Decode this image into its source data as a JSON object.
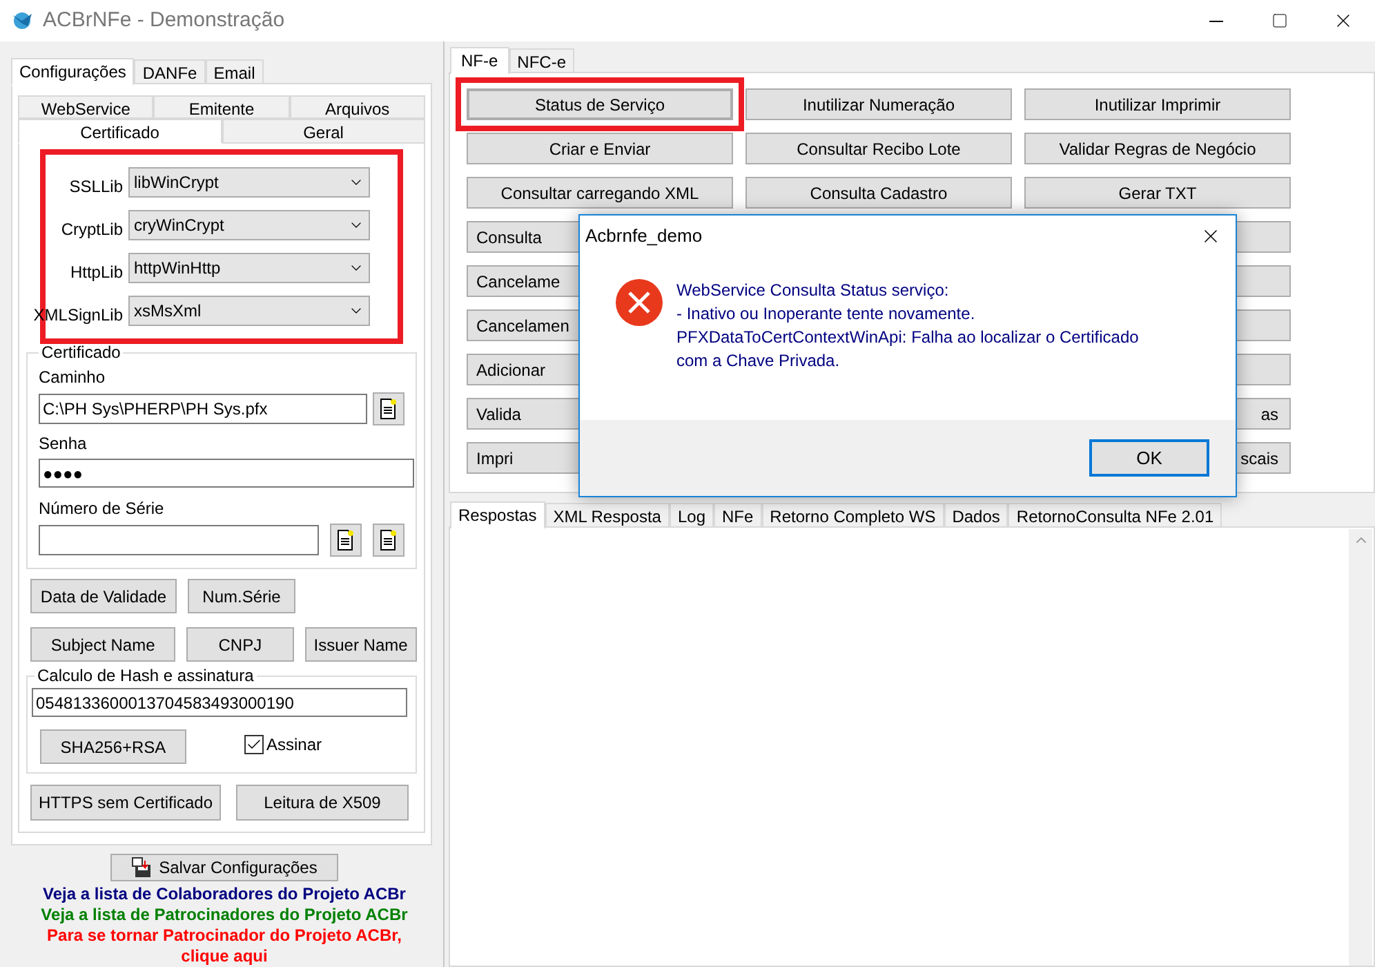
{
  "window": {
    "title": "ACBrNFe - Demonstração"
  },
  "config_tabs": [
    {
      "label": "Configurações",
      "selected": true
    },
    {
      "label": "DANFe",
      "selected": false
    },
    {
      "label": "Email",
      "selected": false
    }
  ],
  "config_subtabs_row1": [
    {
      "label": "WebService",
      "selected": false
    },
    {
      "label": "Emitente",
      "selected": false
    },
    {
      "label": "Arquivos",
      "selected": false
    }
  ],
  "config_subtabs_row2": [
    {
      "label": "Certificado",
      "selected": true
    },
    {
      "label": "Geral",
      "selected": false
    }
  ],
  "lib_settings": {
    "highlighted": true,
    "rows": [
      {
        "label": "SSLLib",
        "value": "libWinCrypt"
      },
      {
        "label": "CryptLib",
        "value": "cryWinCrypt"
      },
      {
        "label": "HttpLib",
        "value": "httpWinHttp"
      },
      {
        "label": "XMLSignLib",
        "value": "xsMsXml"
      }
    ]
  },
  "certificate": {
    "legend": "Certificado",
    "path_label": "Caminho",
    "path_value": "C:\\PH Sys\\PHERP\\PH Sys.pfx",
    "password_label": "Senha",
    "password_value": "●●●●",
    "serial_label": "Número de Série"
  },
  "cert_buttons_row1": [
    "Data de Validade",
    "Num.Série"
  ],
  "cert_buttons_row2": [
    "Subject Name",
    "CNPJ",
    "Issuer Name"
  ],
  "hash": {
    "legend": "Calculo de Hash e assinatura",
    "value": "0548133600013704583493000190",
    "button": "SHA256+RSA",
    "sign": {
      "label": "Assinar",
      "checked": true
    }
  },
  "bottom_buttons": [
    "HTTPS sem Certificado",
    "Leitura de X509"
  ],
  "save_button": "Salvar Configurações",
  "links": [
    {
      "text": "Veja a lista de Colaboradores do Projeto ACBr",
      "color": "#000080"
    },
    {
      "text": "Veja a lista de Patrocinadores do Projeto ACBr",
      "color": "#008000"
    },
    {
      "text": "Para se tornar Patrocinador do Projeto ACBr, clique aqui",
      "color": "#ff0000"
    }
  ],
  "service_tabs": [
    {
      "label": "NF-e",
      "selected": true
    },
    {
      "label": "NFC-e",
      "selected": false
    }
  ],
  "service_buttons": [
    [
      {
        "kind": "button",
        "label": "Status de Serviço",
        "highlighted": true
      },
      {
        "kind": "button",
        "label": "Inutilizar Numeração",
        "highlighted": false
      },
      {
        "kind": "button",
        "label": "Inutilizar Imprimir",
        "highlighted": false
      }
    ],
    [
      {
        "kind": "button",
        "label": "Criar e Enviar",
        "highlighted": false
      },
      {
        "kind": "button",
        "label": "Consultar Recibo Lote",
        "highlighted": false
      },
      {
        "kind": "button",
        "label": "Validar Regras de Negócio",
        "highlighted": false
      }
    ],
    [
      {
        "kind": "button",
        "label": "Consultar carregando XML",
        "highlighted": false
      },
      {
        "kind": "button",
        "label": "Consulta Cadastro",
        "highlighted": false
      },
      {
        "kind": "button",
        "label": "Gerar TXT",
        "highlighted": false
      }
    ],
    [
      {
        "kind": "partial",
        "label": "Consulta"
      },
      {
        "kind": "covered"
      },
      {
        "kind": "partial"
      }
    ],
    [
      {
        "kind": "partial",
        "label": "Cancelame"
      },
      {
        "kind": "covered"
      },
      {
        "kind": "partial"
      }
    ],
    [
      {
        "kind": "partial",
        "label": "Cancelamen"
      },
      {
        "kind": "covered"
      },
      {
        "kind": "partial"
      }
    ],
    [
      {
        "kind": "partial",
        "label": "Adicionar"
      },
      {
        "kind": "covered"
      },
      {
        "kind": "partial"
      }
    ],
    [
      {
        "kind": "partial",
        "label": "Valida"
      },
      {
        "kind": "covered"
      },
      {
        "kind": "partial",
        "label": "as"
      }
    ],
    [
      {
        "kind": "partial",
        "label": "Impri"
      },
      {
        "kind": "covered"
      },
      {
        "kind": "partial",
        "label": "scais"
      }
    ]
  ],
  "response_tabs": [
    {
      "label": "Respostas",
      "selected": true
    },
    {
      "label": "XML Resposta",
      "selected": false
    },
    {
      "label": "Log",
      "selected": false
    },
    {
      "label": "NFe",
      "selected": false
    },
    {
      "label": "Retorno Completo WS",
      "selected": false
    },
    {
      "label": "Dados",
      "selected": false
    },
    {
      "label": "RetornoConsulta NFe 2.01",
      "selected": false
    }
  ],
  "dialog": {
    "title": "Acbrnfe_demo",
    "lines": [
      "WebService Consulta Status serviço:",
      "- Inativo ou Inoperante tente novamente.",
      "PFXDataToCertContextWinApi: Falha ao localizar o Certificado",
      "com a Chave Privada."
    ],
    "button": "OK"
  }
}
